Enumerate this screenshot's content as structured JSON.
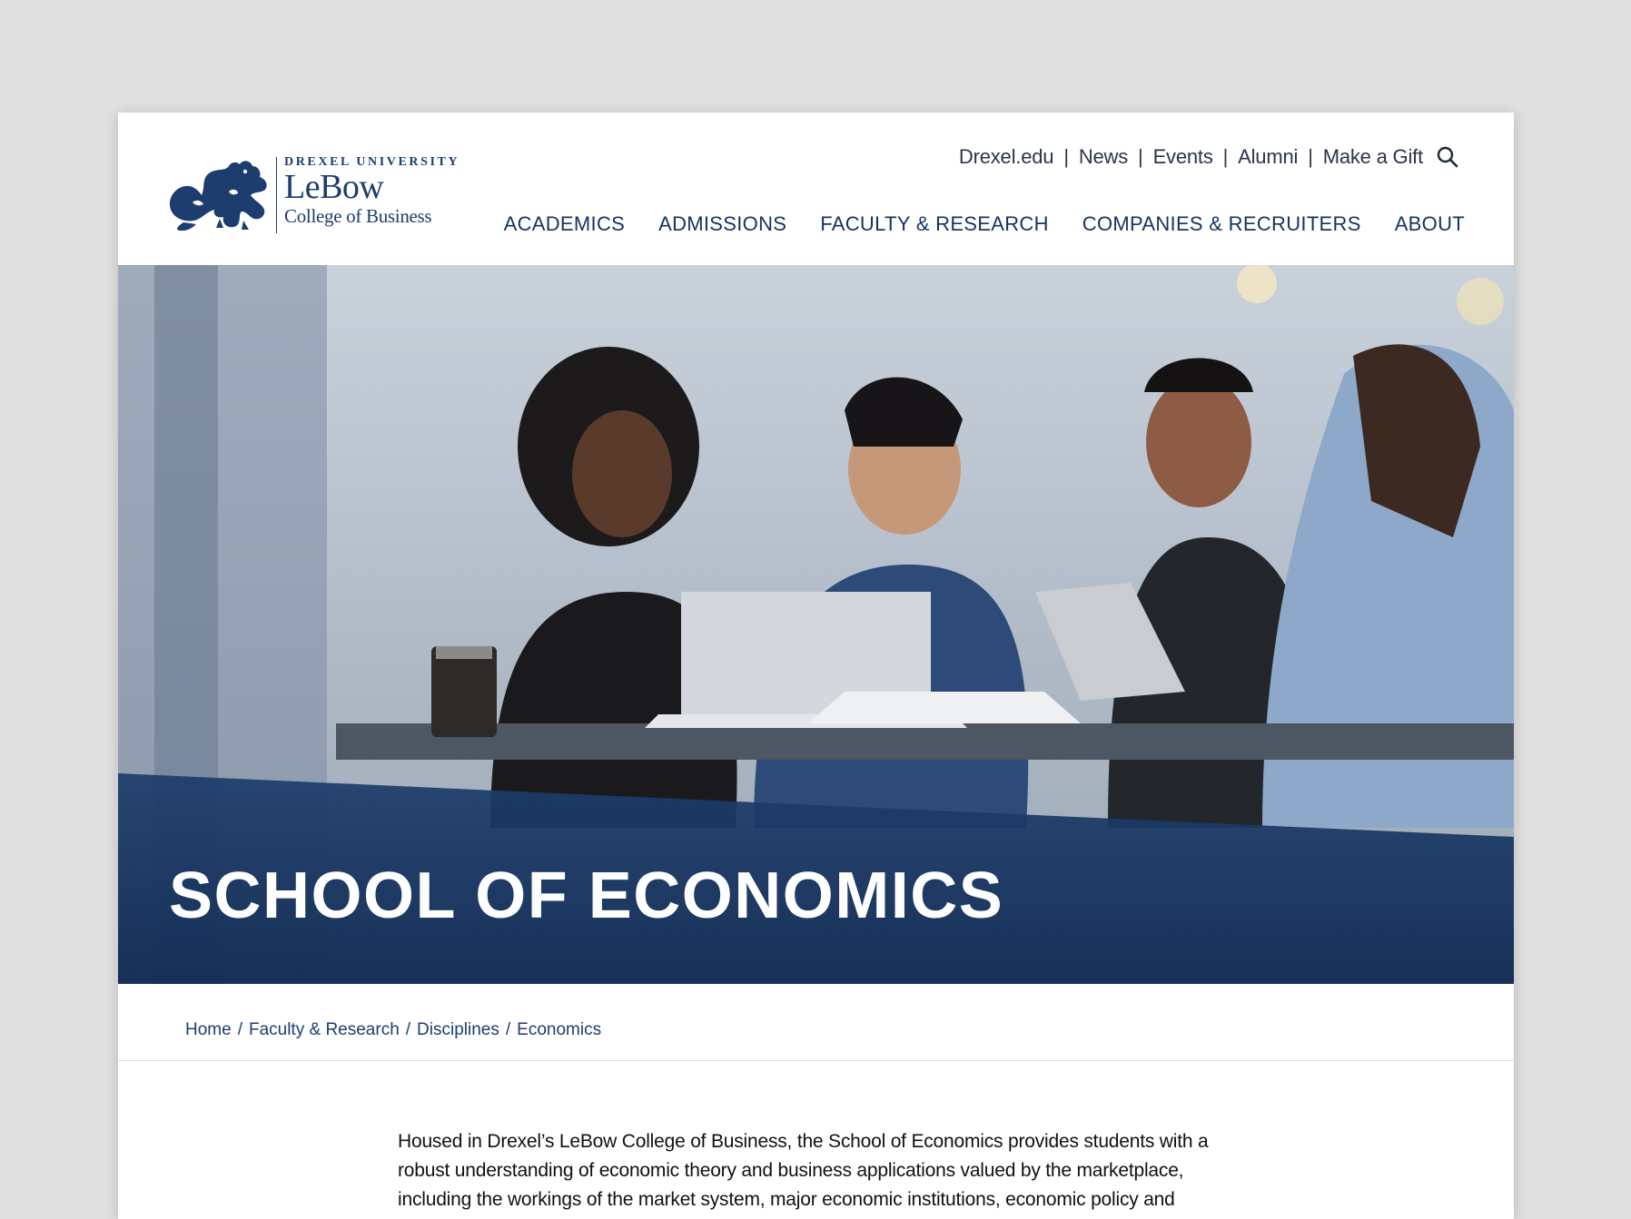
{
  "brand": {
    "university": "DREXEL UNIVERSITY",
    "school": "LeBow",
    "college": "College of Business",
    "color": "#1c3d6e"
  },
  "utility_nav": {
    "links": [
      "Drexel.edu",
      "News",
      "Events",
      "Alumni",
      "Make a Gift"
    ],
    "search_icon": "search-icon"
  },
  "main_nav": {
    "items": [
      "ACADEMICS",
      "ADMISSIONS",
      "FACULTY & RESEARCH",
      "COMPANIES & RECRUITERS",
      "ABOUT"
    ]
  },
  "hero": {
    "title": "SCHOOL OF ECONOMICS",
    "overlay_color": "#16335e"
  },
  "breadcrumb": {
    "items": [
      "Home",
      "Faculty & Research",
      "Disciplines",
      "Economics"
    ]
  },
  "intro": {
    "text": "Housed in Drexel’s LeBow College of Business, the School of Economics provides students with a robust understanding of economic theory and business applications valued by the marketplace, including the workings of the market system, major economic institutions, economic policy and development. Students"
  }
}
